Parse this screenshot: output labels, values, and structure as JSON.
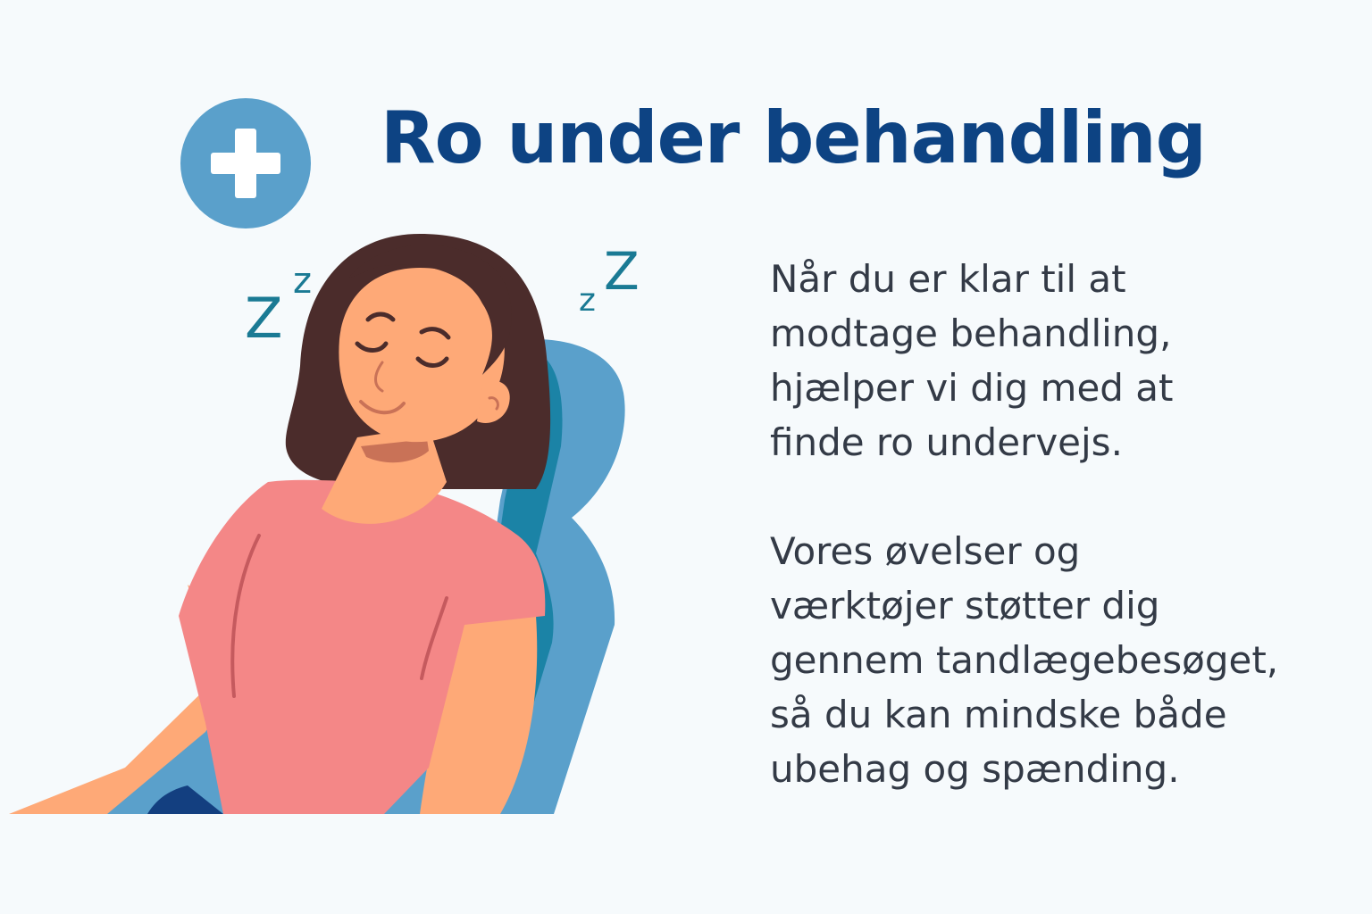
{
  "header": {
    "title": "Ro under behandling"
  },
  "content": {
    "paragraphs": [
      {
        "lines": [
          "Når du er klar til at",
          "modtage behandling,",
          "hjælper vi dig med at",
          "finde ro undervejs."
        ]
      },
      {
        "lines": [
          "Vores øvelser og",
          "værktøjer støtter dig",
          "gennem tandlægebesøget,",
          "så du kan mindske både",
          "ubehag og spænding."
        ]
      }
    ]
  },
  "illustration": {
    "sleep_marks_left": [
      "Z",
      "z"
    ],
    "sleep_marks_right": [
      "z",
      "Z"
    ]
  },
  "colors": {
    "background": "#f6fafc",
    "title": "#0d4383",
    "body_text": "#333a46",
    "badge": "#5aa0cb",
    "chair": "#5aa0cb",
    "chair_shadow": "#1b83a6",
    "hair": "#4b2c2b",
    "skin": "#fea977",
    "shirt": "#f48787",
    "sleep_marks": "#1a7a94"
  },
  "icons": {
    "badge": "medical-cross-icon"
  }
}
